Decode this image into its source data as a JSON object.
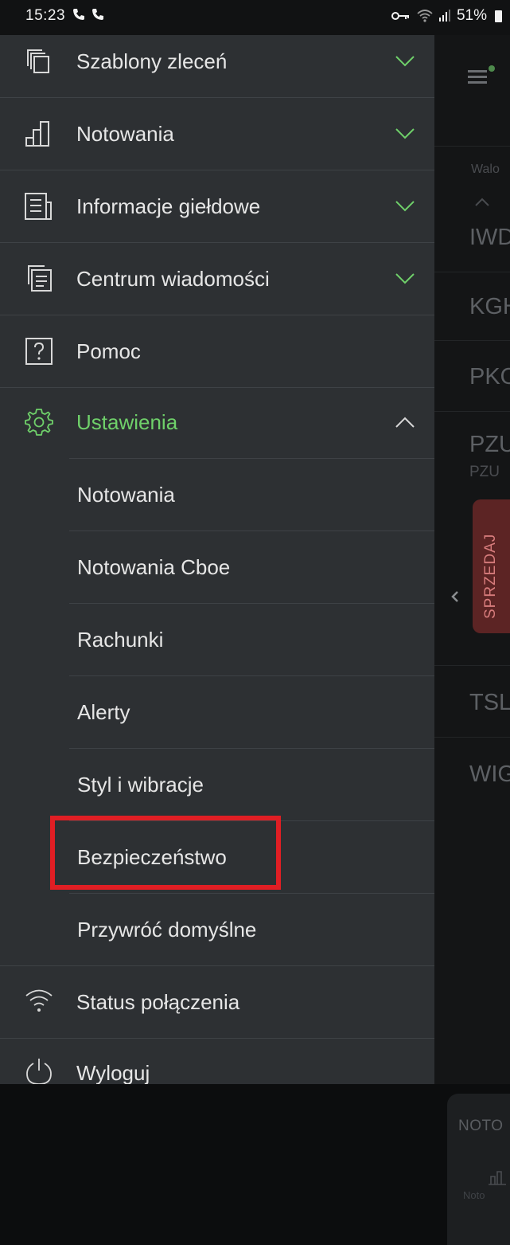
{
  "status_bar": {
    "time": "15:23",
    "battery": "51%",
    "icons": [
      "call-icon",
      "call-icon",
      "vpn-key-icon",
      "wifi-icon",
      "signal-icon",
      "battery-icon"
    ]
  },
  "menu": {
    "top_items": [
      {
        "label": "Szablony zleceń",
        "icon": "copy-icon",
        "expanded": false
      },
      {
        "label": "Notowania",
        "icon": "bar-chart-icon",
        "expanded": false
      },
      {
        "label": "Informacje giełdowe",
        "icon": "news-icon",
        "expanded": false
      },
      {
        "label": "Centrum wiadomości",
        "icon": "messages-icon",
        "expanded": false
      },
      {
        "label": "Pomoc",
        "icon": "help-icon"
      },
      {
        "label": "Ustawienia",
        "icon": "gear-icon",
        "expanded": true
      }
    ],
    "settings_subitems": [
      {
        "label": "Notowania"
      },
      {
        "label": "Notowania Cboe"
      },
      {
        "label": "Rachunki"
      },
      {
        "label": "Alerty"
      },
      {
        "label": "Styl i wibracje"
      },
      {
        "label": "Bezpieczeństwo",
        "highlighted": true
      },
      {
        "label": "Przywróć domyślne"
      }
    ],
    "bottom_items": [
      {
        "label": "Status połączenia",
        "icon": "wifi-icon"
      },
      {
        "label": "Wyloguj",
        "icon": "power-icon"
      }
    ]
  },
  "background": {
    "column_header": "Walo",
    "rows": [
      "IWD",
      "KGH",
      "PKO",
      "PZU",
      "TSL",
      "WIG"
    ],
    "row_sub": "PZU",
    "sell_label": "SPRZEDAJ",
    "bottom_tab": "NOTO",
    "bottom_tab_small": "Noto"
  },
  "colors": {
    "drawer_bg": "#2d3033",
    "accent_green": "#6fd06a",
    "highlight_red": "#e01e24",
    "sell_bg": "#5c2424"
  }
}
